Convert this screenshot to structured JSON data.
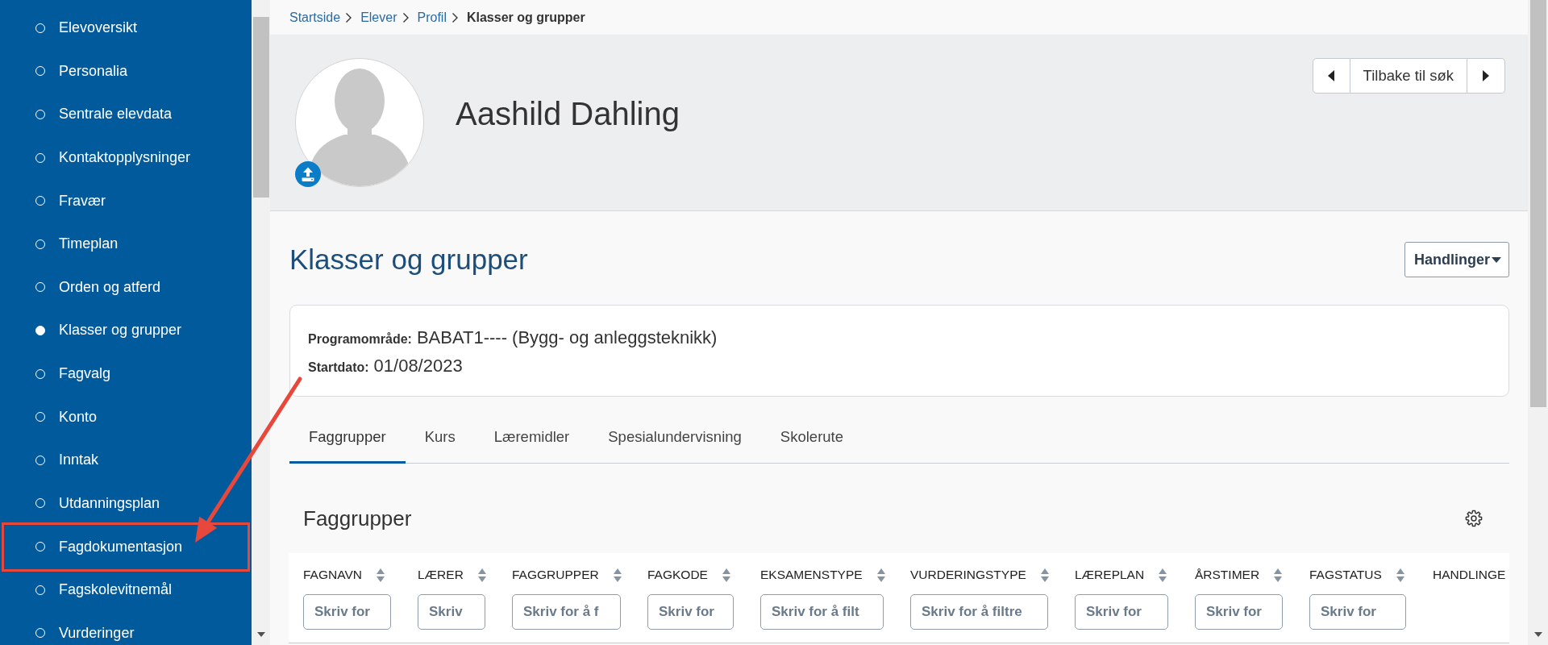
{
  "sidebar": {
    "items": [
      {
        "label": "Elevoversikt",
        "selected": false,
        "highlighted": false
      },
      {
        "label": "Personalia",
        "selected": false,
        "highlighted": false
      },
      {
        "label": "Sentrale elevdata",
        "selected": false,
        "highlighted": false
      },
      {
        "label": "Kontaktopplysninger",
        "selected": false,
        "highlighted": false
      },
      {
        "label": "Fravær",
        "selected": false,
        "highlighted": false
      },
      {
        "label": "Timeplan",
        "selected": false,
        "highlighted": false
      },
      {
        "label": "Orden og atferd",
        "selected": false,
        "highlighted": false
      },
      {
        "label": "Klasser og grupper",
        "selected": true,
        "highlighted": false
      },
      {
        "label": "Fagvalg",
        "selected": false,
        "highlighted": false
      },
      {
        "label": "Konto",
        "selected": false,
        "highlighted": false
      },
      {
        "label": "Inntak",
        "selected": false,
        "highlighted": false
      },
      {
        "label": "Utdanningsplan",
        "selected": false,
        "highlighted": false
      },
      {
        "label": "Fagdokumentasjon",
        "selected": false,
        "highlighted": true
      },
      {
        "label": "Fagskolevitnemål",
        "selected": false,
        "highlighted": false
      },
      {
        "label": "Vurderinger",
        "selected": false,
        "highlighted": false
      }
    ]
  },
  "breadcrumb": [
    {
      "label": "Startside",
      "current": false
    },
    {
      "label": "Elever",
      "current": false
    },
    {
      "label": "Profil",
      "current": false
    },
    {
      "label": "Klasser og grupper",
      "current": true
    }
  ],
  "profile": {
    "name": "Aashild Dahling",
    "back_button": "Tilbake til søk"
  },
  "page": {
    "title": "Klasser og grupper",
    "actions_button": "Handlinger"
  },
  "info": [
    {
      "label": "Programområde:",
      "value": "BABAT1---- (Bygg- og anleggsteknikk)"
    },
    {
      "label": "Startdato:",
      "value": "01/08/2023"
    }
  ],
  "tabs": [
    {
      "label": "Faggrupper",
      "selected": true
    },
    {
      "label": "Kurs",
      "selected": false
    },
    {
      "label": "Læremidler",
      "selected": false
    },
    {
      "label": "Spesialundervisning",
      "selected": false
    },
    {
      "label": "Skolerute",
      "selected": false
    }
  ],
  "section": {
    "title": "Faggrupper"
  },
  "table": {
    "columns": [
      {
        "label": "FAGNAVN",
        "sortable": true,
        "filter": {
          "placeholder": "Skriv for"
        }
      },
      {
        "label": "LÆRER",
        "sortable": true,
        "filter": {
          "placeholder": "Skriv"
        }
      },
      {
        "label": "FAGGRUPPER",
        "sortable": true,
        "filter": {
          "placeholder": "Skriv for å f"
        }
      },
      {
        "label": "FAGKODE",
        "sortable": true,
        "filter": {
          "placeholder": "Skriv for"
        }
      },
      {
        "label": "EKSAMENSTYPE",
        "sortable": true,
        "filter": {
          "placeholder": "Skriv for å filt"
        }
      },
      {
        "label": "VURDERINGSTYPE",
        "sortable": true,
        "filter": {
          "placeholder": "Skriv for å filtre"
        }
      },
      {
        "label": "LÆREPLAN",
        "sortable": true,
        "filter": {
          "placeholder": "Skriv for"
        }
      },
      {
        "label": "ÅRSTIMER",
        "sortable": true,
        "filter": {
          "placeholder": "Skriv for"
        }
      },
      {
        "label": "FAGSTATUS",
        "sortable": true,
        "filter": {
          "placeholder": "Skriv for"
        }
      },
      {
        "label": "HANDLINGE",
        "sortable": false
      }
    ]
  },
  "annotations": [
    {
      "kind": "arrow"
    }
  ]
}
